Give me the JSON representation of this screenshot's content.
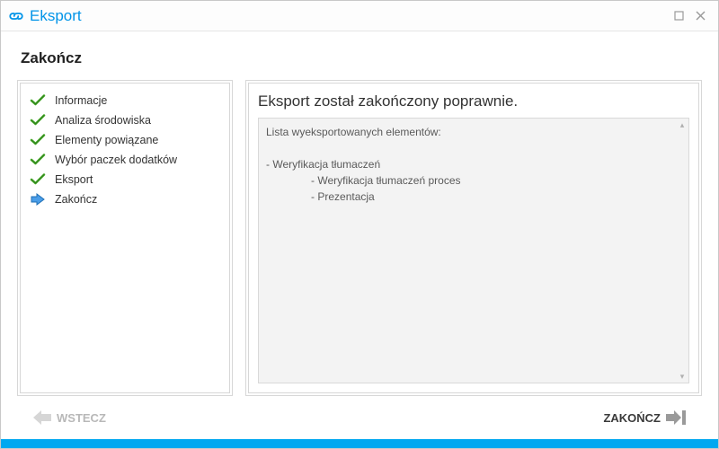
{
  "window": {
    "title": "Eksport"
  },
  "page": {
    "title": "Zakończ"
  },
  "sidebar": {
    "steps": [
      {
        "label": "Informacje",
        "state": "done"
      },
      {
        "label": "Analiza środowiska",
        "state": "done"
      },
      {
        "label": "Elementy powiązane",
        "state": "done"
      },
      {
        "label": "Wybór paczek dodatków",
        "state": "done"
      },
      {
        "label": "Eksport",
        "state": "done"
      },
      {
        "label": "Zakończ",
        "state": "current"
      }
    ]
  },
  "main": {
    "heading": "Eksport został zakończony poprawnie.",
    "log": "Lista wyeksportowanych elementów:\n\n- Weryfikacja tłumaczeń\n               - Weryfikacja tłumaczeń proces\n               - Prezentacja"
  },
  "footer": {
    "back": "WSTECZ",
    "finish": "ZAKOŃCZ"
  },
  "colors": {
    "accent": "#00a8f0",
    "title": "#0094e8"
  }
}
